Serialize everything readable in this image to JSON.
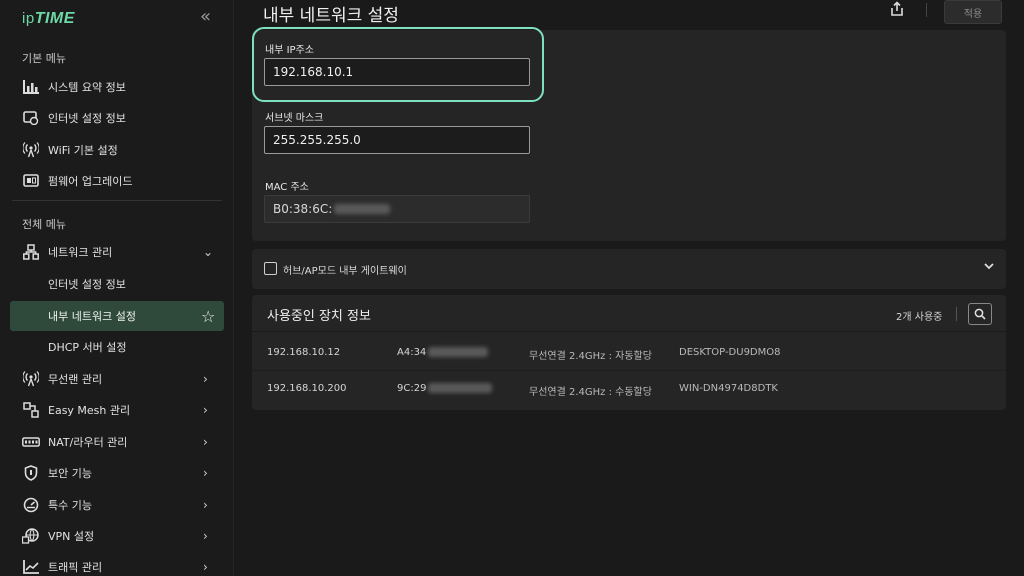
{
  "sidebar": {
    "logo_prefix": "ip",
    "logo_main": "TIME",
    "collapse_icon": "«",
    "basic_menu_title": "기본 메뉴",
    "basic_items": [
      {
        "label": "시스템 요약 정보",
        "icon": "bar-chart-icon"
      },
      {
        "label": "인터넷 설정 정보",
        "icon": "internet-icon"
      },
      {
        "label": "WiFi 기본 설정",
        "icon": "wifi-antenna-icon"
      },
      {
        "label": "펌웨어 업그레이드",
        "icon": "firmware-icon"
      }
    ],
    "all_menu_title": "전체 메뉴",
    "all_items": [
      {
        "label": "네트워크 관리",
        "icon": "network-icon",
        "chevron": "⌄"
      },
      {
        "label": "인터넷 설정 정보"
      },
      {
        "label": "내부 네트워크 설정",
        "active": true,
        "star": "☆"
      },
      {
        "label": "DHCP 서버 설정"
      },
      {
        "label": "무선랜 관리",
        "icon": "wifi-antenna-icon",
        "chevron": "›"
      },
      {
        "label": "Easy Mesh 관리",
        "icon": "mesh-icon",
        "chevron": "›"
      },
      {
        "label": "NAT/라우터 관리",
        "icon": "router-icon",
        "chevron": "›"
      },
      {
        "label": "보안 기능",
        "icon": "shield-icon",
        "chevron": "›"
      },
      {
        "label": "특수 기능",
        "icon": "gauge-icon",
        "chevron": "›"
      },
      {
        "label": "VPN 설정",
        "icon": "vpn-globe-icon",
        "chevron": "›"
      },
      {
        "label": "트래픽 관리",
        "icon": "traffic-chart-icon",
        "chevron": "›"
      }
    ]
  },
  "header": {
    "title": "내부 네트워크 설정",
    "apply_label": "적용"
  },
  "network": {
    "ip_label": "내부 IP주소",
    "ip_value": "192.168.10.1",
    "mask_label": "서브넷 마스크",
    "mask_value": "255.255.255.0",
    "mac_label": "MAC 주소",
    "mac_value": "B0:38:6C:"
  },
  "gateway": {
    "label": "허브/AP모드 내부 게이트웨이",
    "checked": false
  },
  "devices": {
    "title": "사용중인 장치 정보",
    "count_label": "2개 사용중",
    "rows": [
      {
        "ip": "192.168.10.12",
        "mac": "A4:34",
        "connection": "무선연결 2.4GHz : 자동할당",
        "host": "DESKTOP-DU9DMO8"
      },
      {
        "ip": "192.168.10.200",
        "mac": "9C:29",
        "connection": "무선연결 2.4GHz : 수동할당",
        "host": "WIN-DN4974D8DTK"
      }
    ]
  },
  "colors": {
    "accent": "#7fe0bd",
    "active_bg": "#2f4a3a",
    "logo": "#6cd8a6"
  }
}
